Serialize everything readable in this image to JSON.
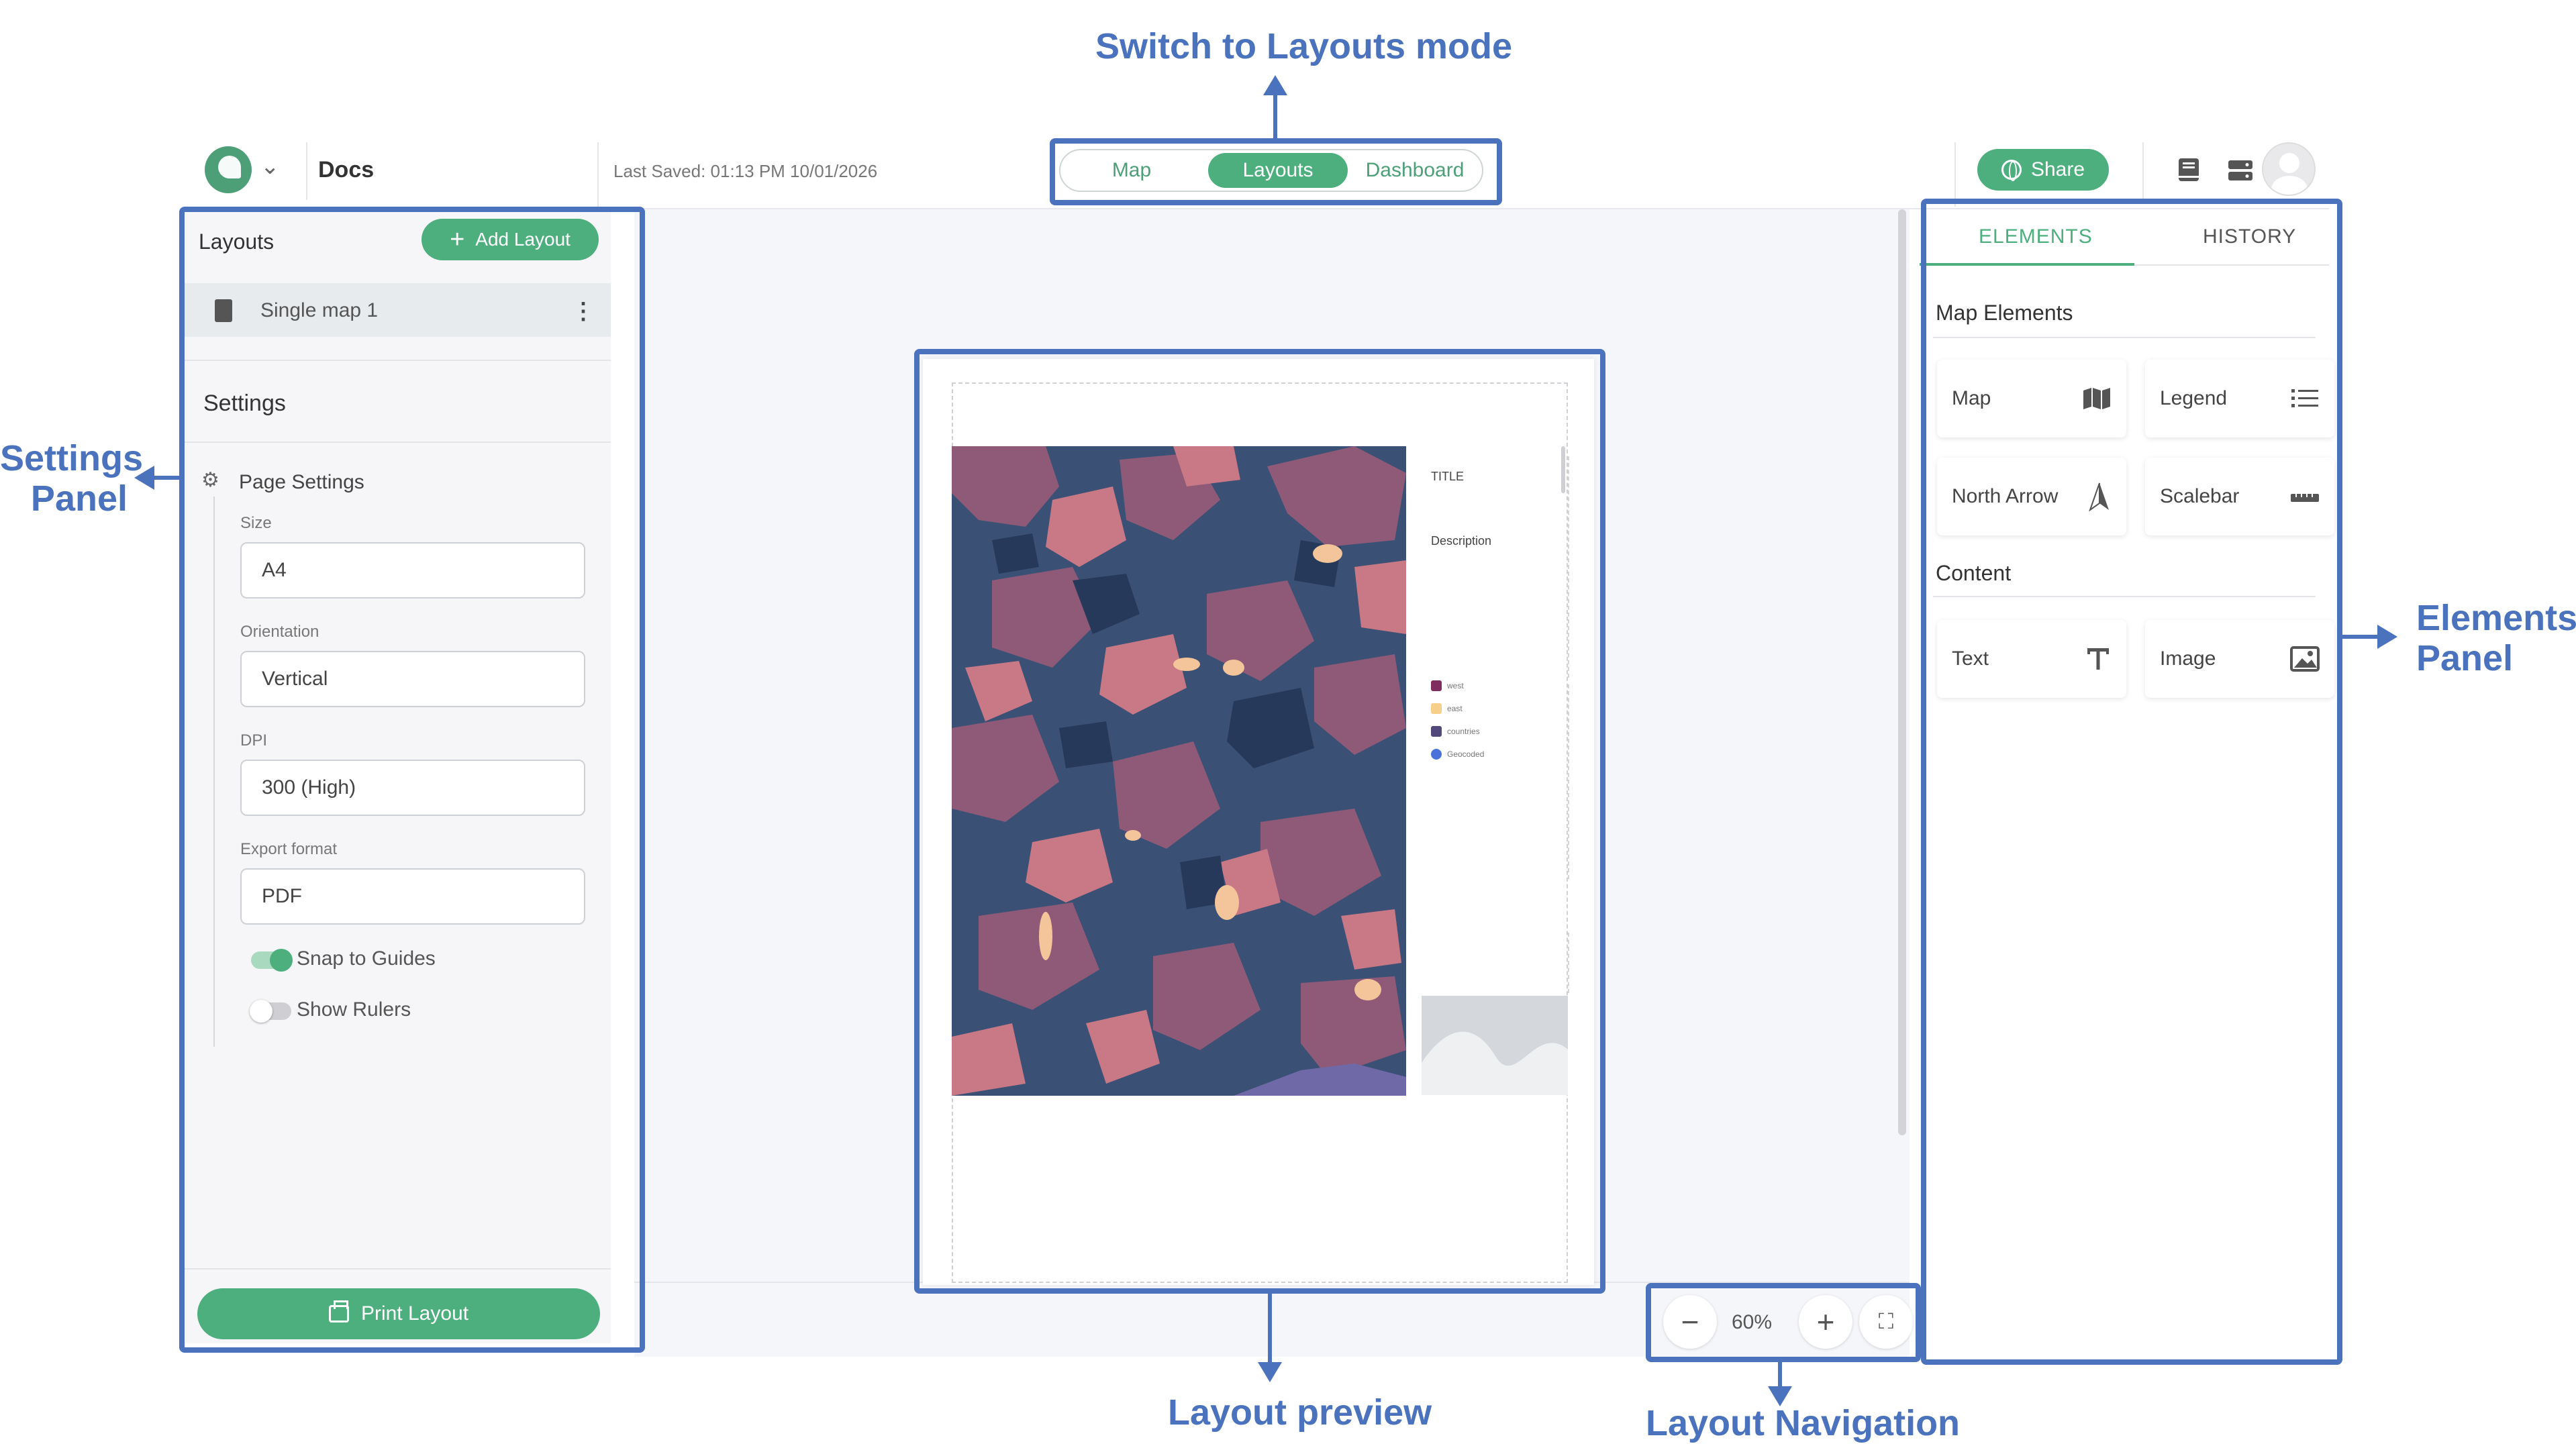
{
  "annotations": {
    "switch_mode": "Switch to Layouts mode",
    "settings_panel_line1": "Settings",
    "settings_panel_line2": "Panel",
    "elements_panel_line1": "Elements",
    "elements_panel_line2": "Panel",
    "layout_preview": "Layout preview",
    "layout_navigation": "Layout Navigation",
    "color": "#4a72bd"
  },
  "header": {
    "app_name": "Docs",
    "last_saved": "Last Saved: 01:13 PM 10/01/2026",
    "modes": [
      "Map",
      "Layouts",
      "Dashboard"
    ],
    "active_mode": "Layouts",
    "share_label": "Share",
    "brand_color": "#4caf7d"
  },
  "left_panel": {
    "layouts_title": "Layouts",
    "add_layout_label": "Add Layout",
    "layouts": [
      {
        "label": "Single map 1"
      }
    ],
    "settings_title": "Settings",
    "page_settings_title": "Page Settings",
    "fields": [
      {
        "label": "Size",
        "value": "A4"
      },
      {
        "label": "Orientation",
        "value": "Vertical"
      },
      {
        "label": "DPI",
        "value": "300 (High)"
      },
      {
        "label": "Export format",
        "value": "PDF"
      }
    ],
    "toggles": [
      {
        "label": "Snap to Guides",
        "on": true
      },
      {
        "label": "Show Rulers",
        "on": false
      }
    ],
    "print_label": "Print Layout"
  },
  "preview": {
    "title": "TITLE",
    "description": "Description",
    "legend": [
      {
        "label": "west",
        "color": "#7e2d5e",
        "shape": "square"
      },
      {
        "label": "east",
        "color": "#f6cf8a",
        "shape": "square"
      },
      {
        "label": "countries",
        "color": "#52487a",
        "shape": "square"
      },
      {
        "label": "Geocoded",
        "color": "#4a72d9",
        "shape": "dot"
      }
    ]
  },
  "navigation": {
    "zoom": "60%"
  },
  "right_panel": {
    "tabs": [
      "ELEMENTS",
      "HISTORY"
    ],
    "active_tab": "ELEMENTS",
    "map_elements_title": "Map Elements",
    "map_elements": [
      {
        "label": "Map",
        "icon": "map-icon"
      },
      {
        "label": "Legend",
        "icon": "list-icon"
      },
      {
        "label": "North Arrow",
        "icon": "north-arrow-icon"
      },
      {
        "label": "Scalebar",
        "icon": "ruler-icon"
      }
    ],
    "content_title": "Content",
    "content_elements": [
      {
        "label": "Text",
        "icon": "text-icon"
      },
      {
        "label": "Image",
        "icon": "image-icon"
      }
    ]
  }
}
